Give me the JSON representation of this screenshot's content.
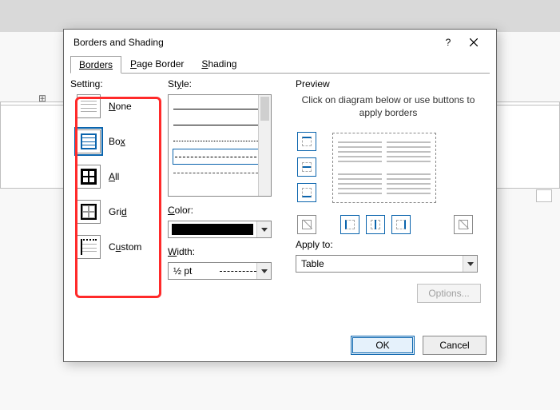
{
  "dialog": {
    "title": "Borders and Shading",
    "help_label": "?",
    "tabs": {
      "borders": "Borders",
      "page_border": "Page Border",
      "shading": "Shading"
    },
    "setting": {
      "label": "Setting:",
      "items": {
        "none": {
          "label": "None",
          "ul": "N"
        },
        "box": {
          "label": "Box",
          "ul": "x"
        },
        "all": {
          "label": "All",
          "ul": "A"
        },
        "grid": {
          "label": "Grid",
          "ul": "d"
        },
        "custom": {
          "label": "Custom",
          "ul": "u"
        }
      }
    },
    "style": {
      "label": "Style:",
      "ul": "y"
    },
    "color": {
      "label": "Color:",
      "ul": "C"
    },
    "width": {
      "label": "Width:",
      "ul": "W",
      "value": "½ pt"
    },
    "preview": {
      "label": "Preview",
      "hint": "Click on diagram below or use buttons to apply borders"
    },
    "apply": {
      "label": "Apply to:",
      "ul": "L",
      "value": "Table"
    },
    "options_label": "Options...",
    "ok_label": "OK",
    "cancel_label": "Cancel"
  }
}
